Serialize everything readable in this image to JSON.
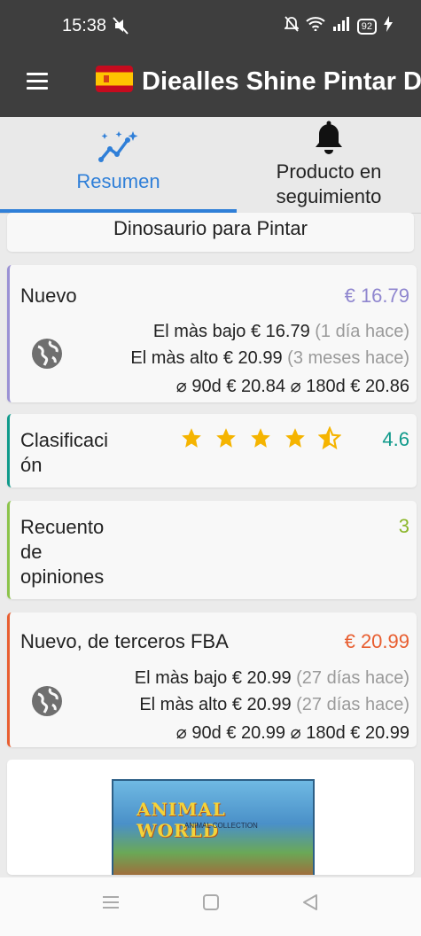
{
  "status_bar": {
    "time": "15:38",
    "battery": "92"
  },
  "app_bar": {
    "title": "Diealles Shine Pintar Di"
  },
  "tabs": [
    {
      "label": "Resumen",
      "icon": "sparkle-chart-icon"
    },
    {
      "label": "Producto en seguimiento",
      "icon": "bell-icon"
    }
  ],
  "product": {
    "name": "Dinosaurio para Pintar"
  },
  "nuevo": {
    "label": "Nuevo",
    "price": "€ 16.79",
    "lowest_label": "El màs bajo",
    "lowest_value": "€ 16.79",
    "lowest_when": "(1 día hace)",
    "highest_label": "El màs alto",
    "highest_value": "€ 20.99",
    "highest_when": "(3 meses hace)",
    "avg_90_label": "⌀ 90d",
    "avg_90": "€ 20.84",
    "avg_180_label": "⌀ 180d",
    "avg_180": "€ 20.86"
  },
  "rating": {
    "label": "Clasificación",
    "label_line1": "Clasificaci",
    "label_line2": "ón",
    "value": "4.6",
    "stars": 4.5
  },
  "reviews": {
    "label_line1": "Recuento",
    "label_line2": "de",
    "label_line3": "opiniones",
    "value": "3"
  },
  "fba": {
    "label": "Nuevo, de terceros FBA",
    "price": "€ 20.99",
    "lowest_label": "El màs bajo",
    "lowest_value": "€ 20.99",
    "lowest_when": "(27 días hace)",
    "highest_label": "El màs alto",
    "highest_value": "€ 20.99",
    "highest_when": "(27 días hace)",
    "avg_90_label": "⌀ 90d",
    "avg_90": "€ 20.99",
    "avg_180_label": "⌀ 180d",
    "avg_180": "€ 20.99"
  },
  "image": {
    "box_title": "ANIMAL WORLD",
    "box_subtitle": "ANIMAL COLLECTION"
  },
  "colors": {
    "accent": "#2f7fd8",
    "nuevo": "#9a91d4",
    "rating": "#109a8b",
    "reviews": "#8bc34a",
    "fba": "#e85e30",
    "star": "#f5b400"
  }
}
